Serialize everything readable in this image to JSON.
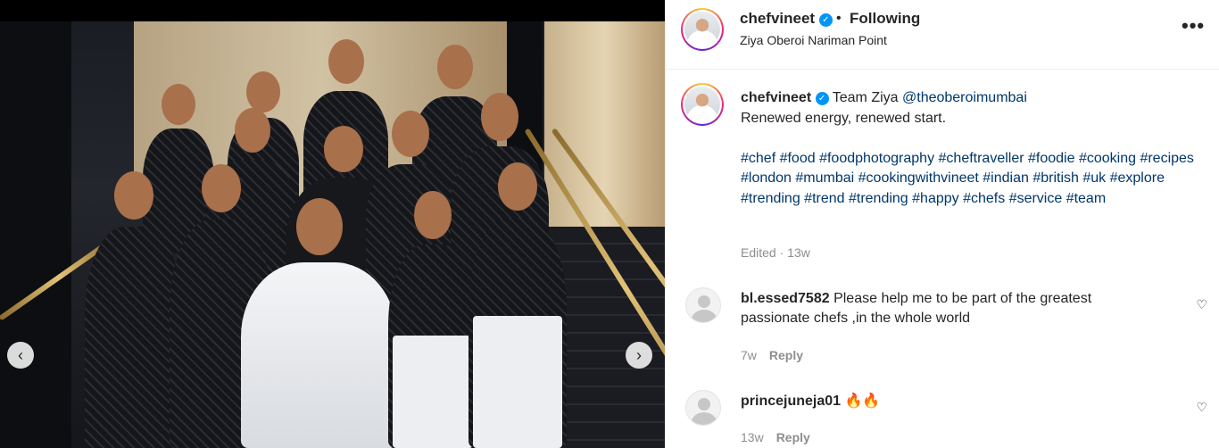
{
  "post": {
    "username": "chefvineet",
    "location": "Ziya Oberoi Nariman Point",
    "follow_status": "Following",
    "separator": "•",
    "more_icon": "more-horizontal-icon"
  },
  "caption": {
    "username": "chefvineet",
    "text_prefix": "Team Ziya ",
    "mention": "@theoberoimumbai",
    "line2": "Renewed energy, renewed start.",
    "hashtags": "#chef #food #foodphotography #cheftraveller #foodie #cooking #recipes #london #mumbai #cookingwithvineet #indian #british #uk #explore #trending #trend #trending #happy #chefs #service #team",
    "edited": "Edited",
    "age_sep": "·",
    "age": "13w"
  },
  "comments": [
    {
      "username": "bl.essed7582",
      "text": "Please help me to be part of the greatest passionate chefs ,in the whole world",
      "age": "7w",
      "reply_label": "Reply"
    },
    {
      "username": "princejuneja01",
      "text": "🔥🔥",
      "age": "13w",
      "reply_label": "Reply"
    }
  ],
  "nav": {
    "prev_icon": "chevron-left-icon",
    "next_icon": "chevron-right-icon"
  },
  "colors": {
    "link": "#00376b",
    "verified": "#0095f6",
    "muted": "#8e8e8e"
  }
}
